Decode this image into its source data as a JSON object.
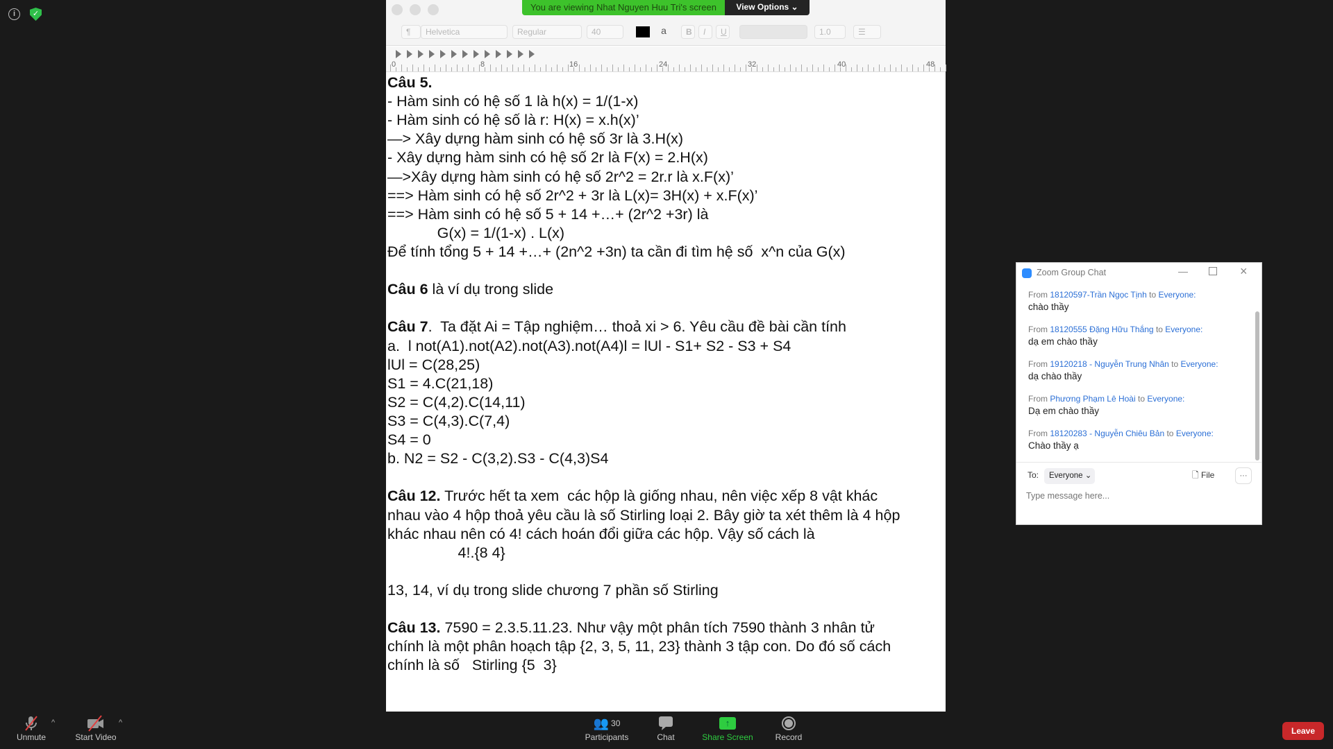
{
  "banner": {
    "text": "You are viewing Nhat Nguyen Huu Tri's screen",
    "view_options": "View Options"
  },
  "toolbar": {
    "paragraph": "¶",
    "font": "Helvetica",
    "style": "Regular",
    "size": "40",
    "bold": "B",
    "italic": "I",
    "underline": "U",
    "spacing": "1.0"
  },
  "ruler": [
    "0",
    "8",
    "16",
    "24",
    "32",
    "40",
    "48"
  ],
  "document": {
    "lines": [
      {
        "b": "Câu 5.",
        "t": ""
      },
      {
        "b": "",
        "t": "- Hàm sinh có hệ số 1 là h(x) = 1/(1-x)"
      },
      {
        "b": "",
        "t": "- Hàm sinh có hệ số là r: H(x) = x.h(x)’"
      },
      {
        "b": "",
        "t": "—> Xây dựng hàm sinh có hệ số 3r là 3.H(x)"
      },
      {
        "b": "",
        "t": "- Xây dựng hàm sinh có hệ số 2r là F(x) = 2.H(x)"
      },
      {
        "b": "",
        "t": "—>Xây dựng hàm sinh có hệ số 2r^2 = 2r.r là x.F(x)’"
      },
      {
        "b": "",
        "t": "==> Hàm sinh có hệ số 2r^2 + 3r là L(x)= 3H(x) + x.F(x)’"
      },
      {
        "b": "",
        "t": "==> Hàm sinh có hệ số 5 + 14 +…+ (2r^2 +3r) là"
      },
      {
        "b": "",
        "t": "            G(x) = 1/(1-x) . L(x)"
      },
      {
        "b": "",
        "t": "Để tính tổng 5 + 14 +…+ (2n^2 +3n) ta cần đi tìm hệ số  x^n của G(x)"
      },
      {
        "b": "",
        "t": ""
      },
      {
        "b": "Câu 6",
        "t": " là ví dụ trong slide"
      },
      {
        "b": "",
        "t": ""
      },
      {
        "b": "Câu 7",
        "t": ".  Ta đặt Ai = Tập nghiệm… thoả xi > 6. Yêu cầu đề bài cần tính"
      },
      {
        "b": "",
        "t": "a.  l not(A1).not(A2).not(A3).not(A4)l = lUl - S1+ S2 - S3 + S4"
      },
      {
        "b": "",
        "t": "lUl = C(28,25)"
      },
      {
        "b": "",
        "t": "S1 = 4.C(21,18)"
      },
      {
        "b": "",
        "t": "S2 = C(4,2).C(14,11)"
      },
      {
        "b": "",
        "t": "S3 = C(4,3).C(7,4)"
      },
      {
        "b": "",
        "t": "S4 = 0"
      },
      {
        "b": "",
        "t": "b. N2 = S2 - C(3,2).S3 - C(4,3)S4"
      },
      {
        "b": "",
        "t": ""
      },
      {
        "b": "Câu 12.",
        "t": " Trước hết ta xem  các hộp là giống nhau, nên việc xếp 8 vật khác"
      },
      {
        "b": "",
        "t": "nhau vào 4 hộp thoả yêu cầu là số Stirling loại 2. Bây giờ ta xét thêm là 4 hộp"
      },
      {
        "b": "",
        "t": "khác nhau nên có 4! cách hoán đổi giữa các hộp. Vậy số cách là"
      },
      {
        "b": "",
        "t": "                 4!.{8 4}"
      },
      {
        "b": "",
        "t": ""
      },
      {
        "b": "",
        "t": "13, 14, ví dụ trong slide chương 7 phần số Stirling"
      },
      {
        "b": "",
        "t": ""
      },
      {
        "b": "Câu 13.",
        "t": " 7590 = 2.3.5.11.23. Như vậy một phân tích 7590 thành 3 nhân tử"
      },
      {
        "b": "",
        "t": "chính là một phân hoạch tập {2, 3, 5, 11, 23} thành 3 tập con. Do đó số cách"
      },
      {
        "b": "",
        "t": "chính là số   Stirling {5  3}"
      }
    ]
  },
  "chat": {
    "title": "Zoom Group Chat",
    "messages": [
      {
        "from": "From ",
        "sender": "18120597-Trần Ngọc Tịnh",
        "to": " to ",
        "target": "Everyone:",
        "text": "chào thầy"
      },
      {
        "from": "From ",
        "sender": "18120555 Đặng Hữu Thắng",
        "to": " to ",
        "target": "Everyone:",
        "text": "dạ em chào thầy"
      },
      {
        "from": "From ",
        "sender": "19120218 - Nguyễn Trung Nhân",
        "to": " to ",
        "target": "Everyone:",
        "text": "dạ chào thầy"
      },
      {
        "from": "From ",
        "sender": "Phương Phạm Lê Hoài",
        "to": " to ",
        "target": "Everyone:",
        "text": "Dạ em chào thầy"
      },
      {
        "from": "From ",
        "sender": "18120283 - Nguyễn Chiêu Bản",
        "to": " to ",
        "target": "Everyone:",
        "text": "Chào thầy ạ"
      }
    ],
    "to_label": "To:",
    "recipient": "Everyone",
    "file": "File",
    "more": "···",
    "placeholder": "Type message here..."
  },
  "bottom": {
    "unmute": "Unmute",
    "start_video": "Start Video",
    "participants": "Participants",
    "participant_count": "30",
    "chat": "Chat",
    "share_screen": "Share Screen",
    "record": "Record",
    "leave": "Leave"
  },
  "colors": {
    "banner": "#3dc22b",
    "leave": "#c8282a",
    "share": "#2ecc40",
    "link": "#2b6fd6"
  }
}
